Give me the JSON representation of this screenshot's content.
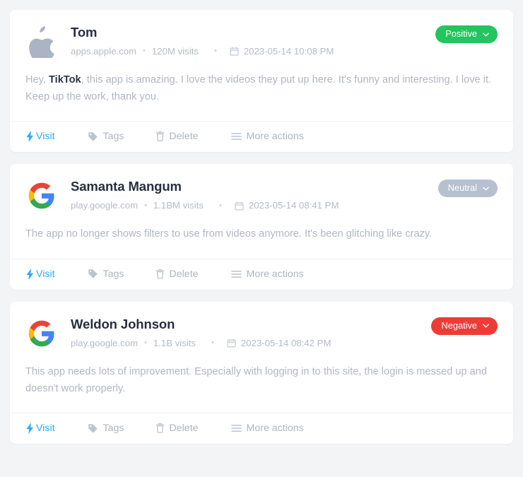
{
  "page": {
    "background_color": "#f3f4f6",
    "card_color": "#ffffff"
  },
  "colors": {
    "positive": "#22c55e",
    "neutral": "#b6c0cf",
    "negative": "#ef3b36",
    "link": "#36a9f4",
    "name": "#252f3f",
    "muted": "#b4bcc8"
  },
  "actions": {
    "visit": "Visit",
    "tags": "Tags",
    "delete": "Delete",
    "more": "More actions"
  },
  "icons": {
    "visit": "lightning-bolt-icon",
    "tags": "tag-icon",
    "delete": "trash-icon",
    "more": "hamburger-menu-icon",
    "calendar": "calendar-icon",
    "chevron": "chevron-down-icon"
  },
  "reviews": [
    {
      "avatar": "apple-logo-icon",
      "name": "Tom",
      "site": "apps.apple.com",
      "visits": "120M visits",
      "date": "2023-05-14 10:08 PM",
      "sentiment": "Positive",
      "sentiment_color": "#22c55e",
      "body_prefix": "Hey, ",
      "body_bold": "TikTok",
      "body_suffix": ", this app is amazing. I love the videos they put up here. It's funny and interesting. I love it. Keep up the work, thank you."
    },
    {
      "avatar": "google-logo-icon",
      "name": "Samanta Mangum",
      "site": "play.google.com",
      "visits": "1.1BM visits",
      "date": "2023-05-14 08:41 PM",
      "sentiment": "Neutral",
      "sentiment_color": "#b6c0cf",
      "body_prefix": "",
      "body_bold": "",
      "body_suffix": "The app no longer shows filters to use from videos anymore. It's been glitching like crazy."
    },
    {
      "avatar": "google-logo-icon",
      "name": "Weldon Johnson",
      "site": "play.google.com",
      "visits": "1.1B visits",
      "date": "2023-05-14 08:42 PM",
      "sentiment": "Negative",
      "sentiment_color": "#ef3b36",
      "body_prefix": "",
      "body_bold": "",
      "body_suffix": "This app needs lots of improvement. Especially with logging in to this site, the login is messed up and doesn't work properly."
    }
  ]
}
